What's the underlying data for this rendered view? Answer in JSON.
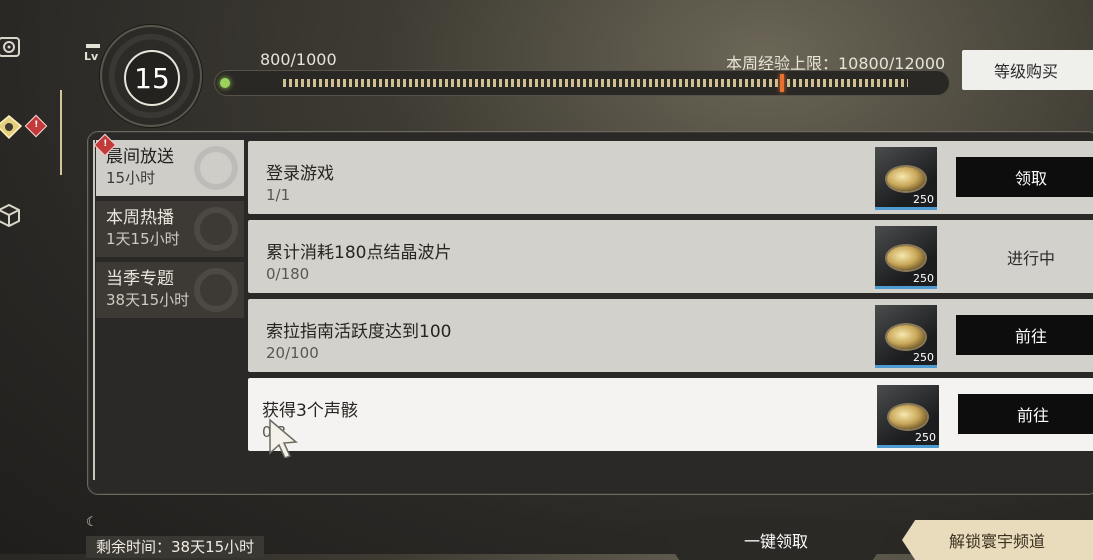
{
  "level": {
    "badge": "Lv",
    "value": "15"
  },
  "xp": {
    "current": "800/1000",
    "weekly_cap": "本周经验上限：10800/12000"
  },
  "buttons": {
    "level_purchase": "等级购买",
    "claim_all": "一键领取",
    "unlock_channel": "解锁寰宇频道"
  },
  "alerts": {
    "mark": "!"
  },
  "tabs": [
    {
      "title": "晨间放送",
      "time": "15小时",
      "active": true
    },
    {
      "title": "本周热播",
      "time": "1天15小时",
      "active": false
    },
    {
      "title": "当季专题",
      "time": "38天15小时",
      "active": false
    }
  ],
  "tasks": [
    {
      "name": "登录游戏",
      "progress": "1/1",
      "reward_count": "250",
      "action": "领取",
      "action_style": "black"
    },
    {
      "name": "累计消耗180点结晶波片",
      "progress": "0/180",
      "reward_count": "250",
      "action": "进行中",
      "action_style": "plain"
    },
    {
      "name": "索拉指南活跃度达到100",
      "progress": "20/100",
      "reward_count": "250",
      "action": "前往",
      "action_style": "black"
    },
    {
      "name": "获得3个声骸",
      "progress": "0/3",
      "reward_count": "250",
      "action": "前往",
      "action_style": "black"
    }
  ],
  "footer": {
    "remaining": "剩余时间：38天15小时"
  },
  "colors": {
    "accent_gold": "#e6d7a8",
    "alert_red": "#c23b3b",
    "xp_marker": "#e8702c",
    "reward_underline": "#4d9bd1"
  }
}
